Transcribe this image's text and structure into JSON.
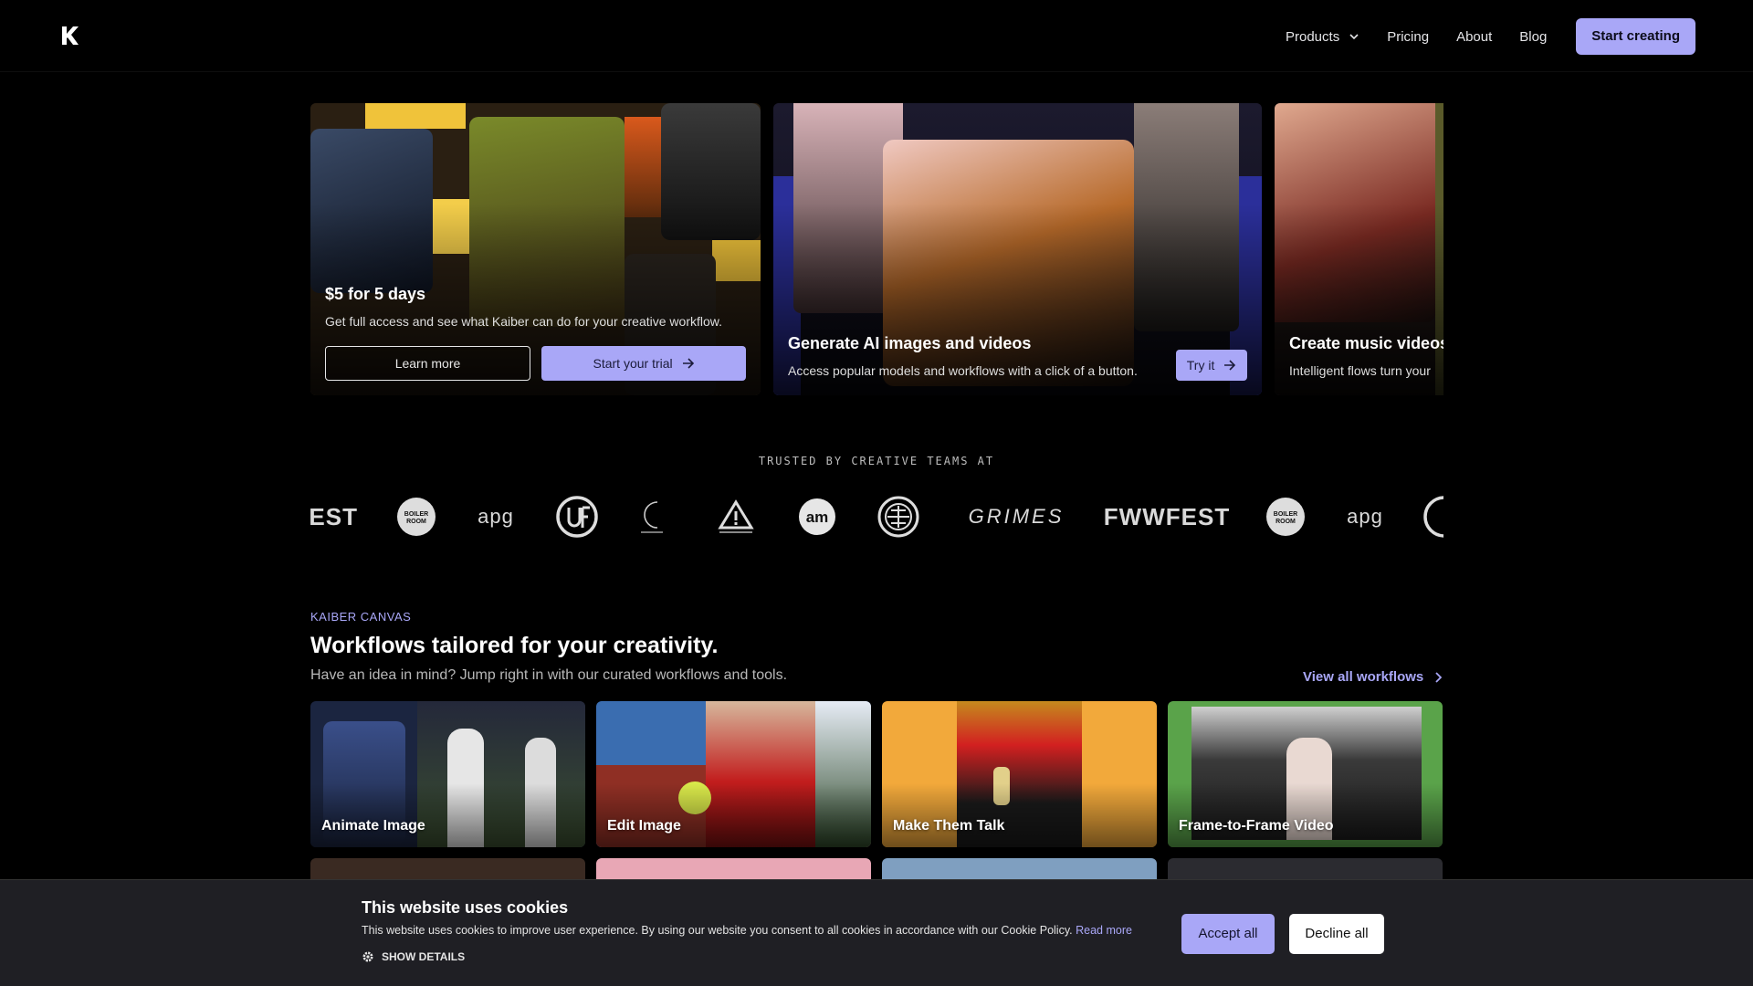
{
  "nav": {
    "products": "Products",
    "pricing": "Pricing",
    "about": "About",
    "blog": "Blog",
    "cta": "Start creating"
  },
  "hero": {
    "cards": [
      {
        "title": "$5 for 5 days",
        "desc": "Get full access and see what Kaiber can do for your creative workflow.",
        "secondary": "Learn more",
        "primary": "Start your trial"
      },
      {
        "title": "Generate AI images and videos",
        "desc": "Access popular models and workflows with a click of a button.",
        "primary": "Try it"
      },
      {
        "title": "Create music videos",
        "desc": "Intelligent flows turn your"
      }
    ]
  },
  "trusted": {
    "label": "TRUSTED BY CREATIVE TEAMS AT",
    "logos": [
      "FEST",
      "BOILER ROOM",
      "apg",
      "UFC",
      "Crescent",
      "Warning",
      "am",
      "Emblem",
      "GRIMES",
      "FWWFEST",
      "BOILER ROOM",
      "apg",
      "Emblem"
    ]
  },
  "canvas": {
    "eyebrow": "KAIBER CANVAS",
    "title": "Workflows tailored for your creativity.",
    "subtitle": "Have an idea in mind? Jump right in with our curated workflows and tools.",
    "view_all": "View all workflows",
    "workflows": [
      {
        "label": "Animate Image"
      },
      {
        "label": "Edit Image"
      },
      {
        "label": "Make Them Talk"
      },
      {
        "label": "Frame-to-Frame Video"
      }
    ]
  },
  "cookie": {
    "title": "This website uses cookies",
    "body": "This website uses cookies to improve user experience. By using our website you consent to all cookies in accordance with our Cookie Policy.",
    "read_more": "Read more",
    "show_details": "SHOW DETAILS",
    "accept": "Accept all",
    "decline": "Decline all"
  },
  "colors": {
    "accent": "#a9a7f7",
    "background": "#000000",
    "cookie_bg": "#1f1f24"
  }
}
